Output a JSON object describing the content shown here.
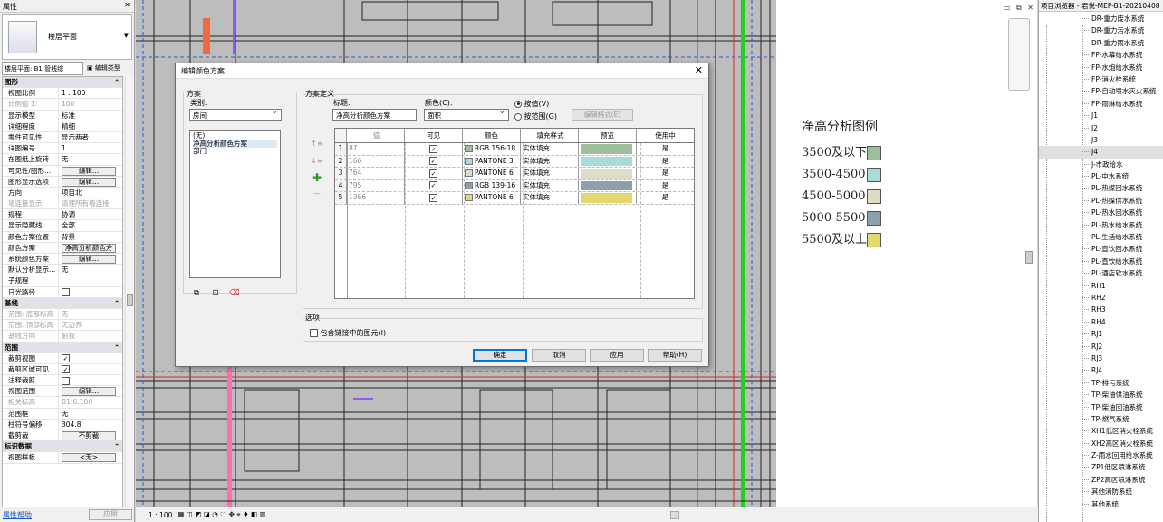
{
  "properties": {
    "title": "属性",
    "type_name": "楼层平面",
    "selector": "楼层平面: B1 管线综",
    "edit_type": "编辑类型",
    "rows": [
      {
        "k": "图形",
        "sec": true
      },
      {
        "k": "视图比例",
        "v": "1 : 100"
      },
      {
        "k": "比例值 1:",
        "v": "100",
        "dim": true
      },
      {
        "k": "显示模型",
        "v": "标准"
      },
      {
        "k": "详细程度",
        "v": "精细"
      },
      {
        "k": "零件可见性",
        "v": "显示两者"
      },
      {
        "k": "详图编号",
        "v": "1"
      },
      {
        "k": "在图纸上旋转",
        "v": "无"
      },
      {
        "k": "可见性/图形...",
        "btn": "编辑..."
      },
      {
        "k": "图形显示选项",
        "btn": "编辑..."
      },
      {
        "k": "方向",
        "v": "项目北"
      },
      {
        "k": "墙连接显示",
        "v": "清理所有墙连接",
        "dim": true
      },
      {
        "k": "规程",
        "v": "协调"
      },
      {
        "k": "显示隐藏线",
        "v": "全部"
      },
      {
        "k": "颜色方案位置",
        "v": "背景"
      },
      {
        "k": "颜色方案",
        "btn": "净高分析颜色方"
      },
      {
        "k": "系统颜色方案",
        "btn": "编辑..."
      },
      {
        "k": "默认分析显示...",
        "v": "无"
      },
      {
        "k": "子规程",
        "v": ""
      },
      {
        "k": "日光路径",
        "chk": false
      },
      {
        "k": "基线",
        "sec": true
      },
      {
        "k": "范围: 底部标高",
        "v": "无",
        "dim": true
      },
      {
        "k": "范围: 顶部标高",
        "v": "无边界",
        "dim": true
      },
      {
        "k": "基线方向",
        "v": "俯视",
        "dim": true
      },
      {
        "k": "范围",
        "sec": true
      },
      {
        "k": "裁剪视图",
        "chk": true
      },
      {
        "k": "裁剪区域可见",
        "chk": true
      },
      {
        "k": "注释裁剪",
        "chk": false
      },
      {
        "k": "视图范围",
        "btn": "编辑..."
      },
      {
        "k": "相关标高",
        "v": "B1-6.100",
        "dim": true
      },
      {
        "k": "范围框",
        "v": "无"
      },
      {
        "k": "柱符号偏移",
        "v": "304.8"
      },
      {
        "k": "截剪裁",
        "btn": "不剪裁"
      },
      {
        "k": "标识数据",
        "sec": true
      },
      {
        "k": "视图样板",
        "btn": "<无>"
      }
    ],
    "help_link": "属性帮助",
    "apply": "应用"
  },
  "status": {
    "scale": "1 : 100"
  },
  "legend": {
    "title": "净高分析图例",
    "items": [
      {
        "label": "3500及以下",
        "color": "#9cbf9a"
      },
      {
        "label": "3500-4500",
        "color": "#a8dcd6"
      },
      {
        "label": "4500-5000",
        "color": "#dcdcc8"
      },
      {
        "label": "5000-5500",
        "color": "#8c9faa"
      },
      {
        "label": "5500及以上",
        "color": "#e3d870"
      }
    ]
  },
  "browser": {
    "title": "项目浏览器 - 君悦-MEP-B1-20210408",
    "items": [
      "DR-重力废水系统",
      "DR-重力污水系统",
      "DR-重力雨水系统",
      "FP-水幕给水系统",
      "FP-水炮给水系统",
      "FP-消火栓系统",
      "FP-自动喷水灭火系统",
      "FP-雨淋给水系统",
      "J1",
      "J2",
      "J3",
      "J4",
      "J-市政给水",
      "PL-中水系统",
      "PL-热媒回水系统",
      "PL-热媒供水系统",
      "PL-热水回水系统",
      "PL-热水给水系统",
      "PL-生活给水系统",
      "PL-直饮回水系统",
      "PL-直饮给水系统",
      "PL-酒店软水系统",
      "RH1",
      "RH2",
      "RH3",
      "RH4",
      "RJ1",
      "RJ2",
      "RJ3",
      "RJ4",
      "TP-排污系统",
      "TP-柴油供油系统",
      "TP-柴油回油系统",
      "TP-燃气系统",
      "XH1低区消火栓系统",
      "XH2高区消火栓系统",
      "Z-雨水回用给水系统",
      "ZP1低区喷淋系统",
      "ZP2高区喷淋系统",
      "其他消防系统",
      "其他系统"
    ],
    "selected": 11
  },
  "dialog": {
    "title": "编辑颜色方案",
    "scheme_group": "方案",
    "category_label": "类别:",
    "category_value": "房间",
    "schemes": [
      "(无)",
      "净高分析颜色方案",
      "部门"
    ],
    "selected_scheme": 1,
    "definition_group": "方案定义",
    "name_label": "标题:",
    "name_value": "净高分析颜色方案",
    "color_label": "颜色(C):",
    "color_value": "面积",
    "by_value": "按值(V)",
    "by_range": "按范围(G)",
    "edit_format": "编辑格式(E)",
    "headers": [
      "值",
      "可见",
      "颜色",
      "填充样式",
      "预览",
      "使用中"
    ],
    "rows": [
      {
        "n": "1",
        "value": "87",
        "visible": true,
        "color": "RGB 156-18",
        "sw": "#9cbf9a",
        "fill": "实体填充",
        "used": "是"
      },
      {
        "n": "2",
        "value": "166",
        "visible": true,
        "color": "PANTONE 3",
        "sw": "#a8dcd6",
        "fill": "实体填充",
        "used": "是"
      },
      {
        "n": "3",
        "value": "764",
        "visible": true,
        "color": "PANTONE 6",
        "sw": "#dcdcc8",
        "fill": "实体填充",
        "used": "是"
      },
      {
        "n": "4",
        "value": "795",
        "visible": true,
        "color": "RGB 139-16",
        "sw": "#8c9faa",
        "fill": "实体填充",
        "used": "是"
      },
      {
        "n": "5",
        "value": "1366",
        "visible": true,
        "color": "PANTONE 6",
        "sw": "#e3d870",
        "fill": "实体填充",
        "used": "是"
      }
    ],
    "options_group": "选项",
    "include_linked": "包含链接中的图元(I)",
    "ok": "确定",
    "cancel": "取消",
    "apply": "应用",
    "help": "帮助(H)"
  }
}
